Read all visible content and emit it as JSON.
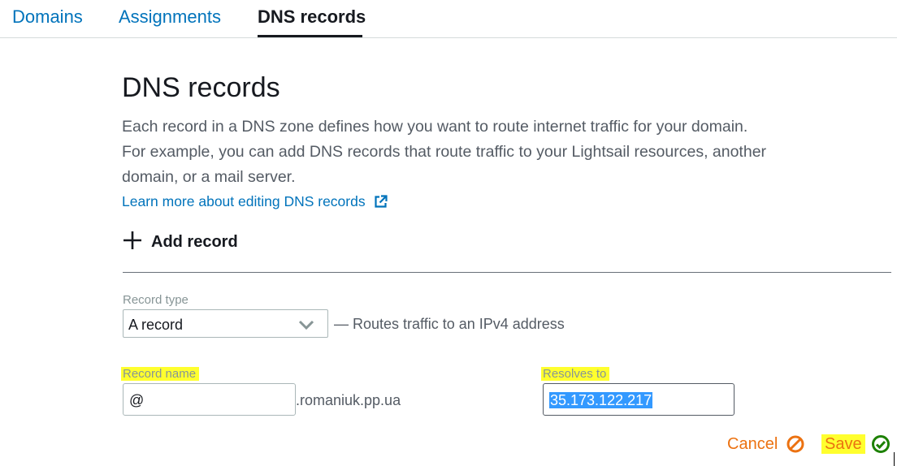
{
  "tabs": [
    {
      "label": "Domains",
      "active": false
    },
    {
      "label": "Assignments",
      "active": false
    },
    {
      "label": "DNS records",
      "active": true
    }
  ],
  "page": {
    "title": "DNS records",
    "description": "Each record in a DNS zone defines how you want to route internet traffic for your domain. For example, you can add DNS records that route traffic to your Lightsail resources, another domain, or a mail server.",
    "learn_more": "Learn more about editing DNS records",
    "learn_more_icon": "external-link-icon"
  },
  "add_record": {
    "label": "Add record",
    "icon": "plus-icon"
  },
  "form": {
    "record_type": {
      "label": "Record type",
      "value": "A record",
      "hint": "— Routes traffic to an IPv4 address",
      "icon": "chevron-down-icon"
    },
    "record_name": {
      "label": "Record name",
      "value": "@",
      "suffix": ".romaniuk.pp.ua"
    },
    "resolves_to": {
      "label": "Resolves to",
      "value": "35.173.122.217"
    }
  },
  "actions": {
    "cancel": {
      "label": "Cancel",
      "icon": "cancel-icon",
      "color": "#ec7211"
    },
    "save": {
      "label": "Save",
      "icon": "check-circle-icon",
      "icon_color": "#1d8102"
    }
  },
  "colors": {
    "link": "#0073bb",
    "highlight": "#ffff2e",
    "selection": "#3399ff"
  }
}
